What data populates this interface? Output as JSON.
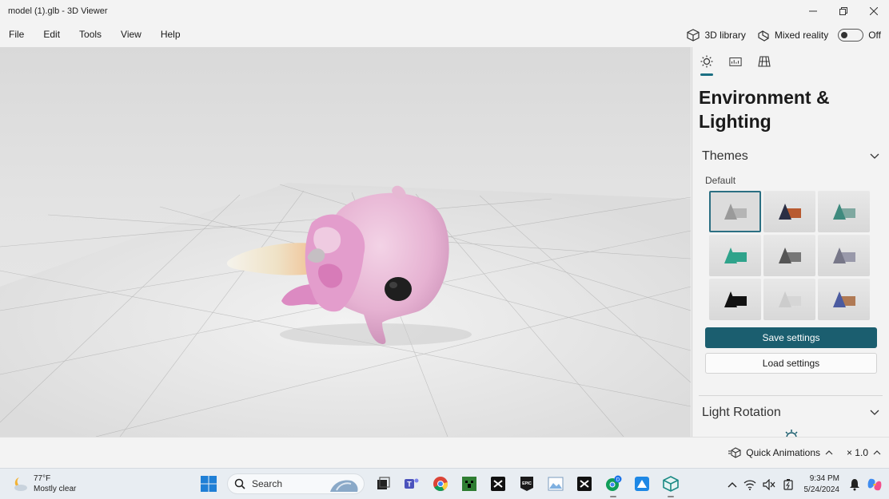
{
  "window": {
    "title": "model (1).glb - 3D Viewer",
    "minimize_icon": "minimize-icon",
    "maximize_icon": "restore-icon",
    "close_icon": "close-icon"
  },
  "menu": {
    "items": [
      "File",
      "Edit",
      "Tools",
      "View",
      "Help"
    ],
    "library_label": "3D library",
    "mixed_reality_label": "Mixed reality",
    "toggle_state": "Off"
  },
  "panel": {
    "tabs": [
      "sun-icon",
      "stats-icon",
      "grid-icon"
    ],
    "title": "Environment & Lighting",
    "themes_label": "Themes",
    "default_label": "Default",
    "themes": [
      {
        "shape": "#9a9a9a",
        "box": "#b5b5b5"
      },
      {
        "shape": "#2b2f45",
        "box": "#b85a30"
      },
      {
        "shape": "#3f8a7e",
        "box": "#7fa8a0"
      },
      {
        "shape": "#2fa38b",
        "box": "#2fa38b"
      },
      {
        "shape": "#555555",
        "box": "#777777"
      },
      {
        "shape": "#777788",
        "box": "#9999aa"
      },
      {
        "shape": "#111111",
        "box": "#111111"
      },
      {
        "shape": "#cccccc",
        "box": "#d6d6d6"
      },
      {
        "shape": "#4b5ba0",
        "box": "#b07a55"
      }
    ],
    "save_label": "Save settings",
    "load_label": "Load settings",
    "light_rotation_label": "Light Rotation"
  },
  "status": {
    "quick_animations_label": "Quick Animations",
    "speed_label": "× 1.0"
  },
  "taskbar": {
    "weather_temp": "77°F",
    "weather_desc": "Mostly clear",
    "search_placeholder": "Search",
    "time": "9:34 PM",
    "date": "5/24/2024",
    "badge": "D"
  },
  "colors": {
    "accent": "#1b5e6f",
    "model_pink": "#e8b4d6"
  }
}
